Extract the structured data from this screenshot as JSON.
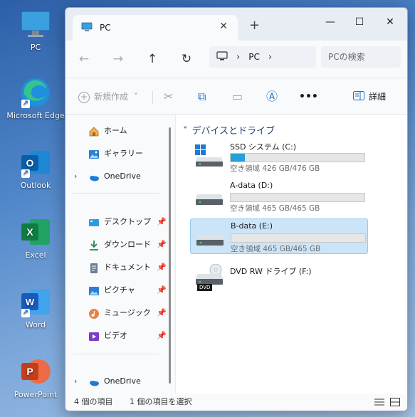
{
  "desktop": {
    "icons": [
      {
        "label": "PC",
        "icon": "monitor-icon"
      },
      {
        "label": "Microsoft Edge",
        "icon": "edge-icon"
      },
      {
        "label": "Outlook",
        "icon": "outlook-icon"
      },
      {
        "label": "Excel",
        "icon": "excel-icon"
      },
      {
        "label": "Word",
        "icon": "word-icon"
      },
      {
        "label": "PowerPoint",
        "icon": "powerpoint-icon"
      }
    ]
  },
  "window": {
    "tab_title": "PC",
    "tab_close": "✕",
    "new_tab": "+",
    "controls": {
      "minimize": "—",
      "maximize": "☐",
      "close": "✕"
    },
    "nav": {
      "back": "←",
      "forward": "→",
      "up": "↑",
      "refresh": "↻"
    },
    "address": {
      "sep1": "›",
      "location": "PC",
      "sep2": "›"
    },
    "search_placeholder": "PCの検索",
    "toolbar": {
      "new_label": "新規作成",
      "new_caret": "˅",
      "cut": "✂",
      "copy": "⧉",
      "paste": "▭",
      "rename": "Ⓐ",
      "more": "•••",
      "detail_label": "詳細"
    },
    "navpane": {
      "home": "ホーム",
      "gallery": "ギャラリー",
      "onedrive1": "OneDrive",
      "desktop": "デスクトップ",
      "downloads": "ダウンロード",
      "documents": "ドキュメント",
      "pictures": "ピクチャ",
      "music": "ミュージック",
      "videos": "ビデオ",
      "onedrive2": "OneDrive",
      "chevron": "›",
      "pin": "📌"
    },
    "group_header": "デバイスとドライブ",
    "group_chevron": "˅",
    "drives": [
      {
        "name": "SSD システム (C:)",
        "free": "空き領域 426 GB/476 GB",
        "used_fraction": 0.105,
        "selected": false
      },
      {
        "name": "A-data (D:)",
        "free": "空き領域 465 GB/465 GB",
        "used_fraction": 0.0,
        "selected": false
      },
      {
        "name": "B-data (E:)",
        "free": "空き領域 465 GB/465 GB",
        "used_fraction": 0.0,
        "selected": true
      },
      {
        "name": "DVD RW ドライブ (F:)",
        "dvd_badge": "DVD"
      }
    ],
    "status": {
      "count": "4 個の項目",
      "selection": "1 個の項目を選択"
    }
  },
  "colors": {
    "accent": "#26a0da",
    "selection": "#cce4f7",
    "header": "#1f3f6f"
  }
}
